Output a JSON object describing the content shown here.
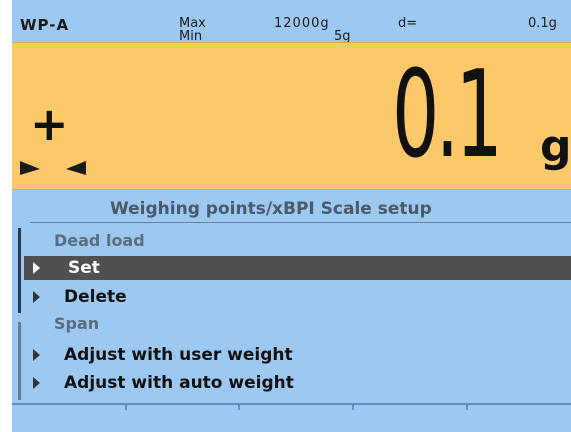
{
  "header": {
    "scale_id": "WP-A",
    "max_label": "Max",
    "min_label": "Min",
    "max_value": "12000g",
    "min_value": "5g",
    "d_label": "d=",
    "d_value": "0.1g"
  },
  "display": {
    "sign": "+",
    "weight": "0.1",
    "unit": "g",
    "stability_icon": "stability-indicator-icon"
  },
  "menu": {
    "title": "Weighing points/xBPI Scale setup",
    "groups": [
      {
        "label": "Dead load",
        "items": [
          {
            "label": "Set",
            "selected": true
          },
          {
            "label": "Delete",
            "selected": false
          }
        ]
      },
      {
        "label": "Span",
        "items": [
          {
            "label": "Adjust with user weight",
            "selected": false
          },
          {
            "label": "Adjust with auto weight",
            "selected": false
          }
        ]
      }
    ]
  },
  "colors": {
    "screen_bg": "#9cc8f2",
    "display_bg": "#fbc96a",
    "selected_bg": "#505050"
  }
}
